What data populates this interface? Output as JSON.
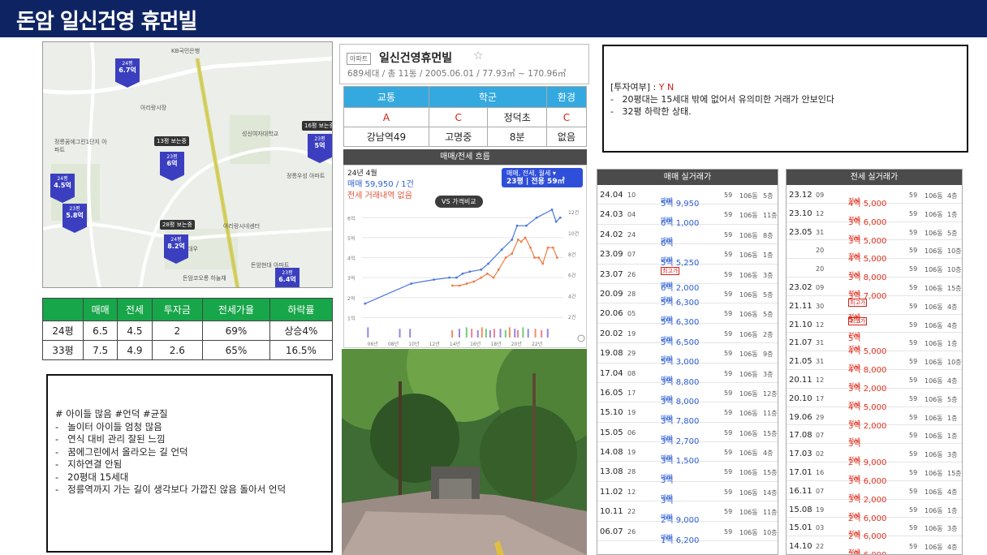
{
  "header": {
    "title": "돈암 일신건영 휴먼빌"
  },
  "map": {
    "pins": [
      {
        "py": "24평",
        "price": "6.7억"
      },
      {
        "py": "23평",
        "price": "6억"
      },
      {
        "py": "24평",
        "price": "4.5억"
      },
      {
        "py": "23평",
        "price": "5.8억"
      },
      {
        "py": "24평",
        "price": "8.2억"
      },
      {
        "py": "23평",
        "price": "5억"
      },
      {
        "py": "23평",
        "price": "6.4억"
      }
    ],
    "tags": [
      "13평 보는중",
      "28평 보는중",
      "16평 보는중"
    ],
    "labels": [
      "KB국민은행",
      "정릉꿈에그린1단지 아파트",
      "아리랑시장",
      "대우",
      "성신여자대학교",
      "정릉우성 아파트",
      "아리랑시네센터",
      "돈암코오롱 하늘채",
      "돈암현대 아파트"
    ]
  },
  "stats": {
    "headers": [
      "",
      "매매",
      "전세",
      "투자금",
      "전세가율",
      "하락률"
    ],
    "rows": [
      [
        "24평",
        "6.5",
        "4.5",
        "2",
        "69%",
        "상승4%"
      ],
      [
        "33평",
        "7.5",
        "4.9",
        "2.6",
        "65%",
        "16.5%"
      ]
    ]
  },
  "notes": {
    "tags": "# 아이들 많음 #언덕 #균질",
    "items": [
      "놀이터 아이들 엄청 많음",
      "연식 대비 관리 잘된 느낌",
      "꿈에그린에서 올라오는 길 언덕",
      "지하연결 안됨",
      "20평대 15세대",
      "정릉역까지 가는 길이 생각보다 가깝진 않음 돌아서 언덕"
    ]
  },
  "apt": {
    "badge": "아파트",
    "name": "일신건영휴먼빌",
    "star": "☆",
    "meta": "689세대 / 총 11동 / 2005.06.01 / 77.93㎡ ~ 170.96㎡"
  },
  "region": {
    "headers": [
      "교통",
      "학군",
      "환경"
    ],
    "grades": [
      "A",
      "C",
      "정덕초",
      "C"
    ],
    "details": [
      "강남역49",
      "고명중",
      "8분",
      "없음"
    ]
  },
  "chart": {
    "bar_title": "매매/전세 흐름",
    "date": "24년 4월",
    "sale": "매매 59,950 / 1건",
    "jeonse": "전세 거래내역 없음",
    "filter_line1": "매매, 전세, 월세 ▾",
    "filter_line2": "23평 | 전용 59㎡",
    "vs": "VS 가격비교"
  },
  "chart_data": {
    "type": "line",
    "x": [
      "06년",
      "08년",
      "10년",
      "12년",
      "14년",
      "16년",
      "18년",
      "20년",
      "22년"
    ],
    "yleft": [
      "1억",
      "2억",
      "3억",
      "4억",
      "5억",
      "6억"
    ],
    "yright": [
      "2건",
      "4건",
      "6건",
      "8건",
      "10건",
      "12건"
    ],
    "ylim": [
      0,
      6.5
    ],
    "series": [
      {
        "name": "매매",
        "color": "#4a77e0",
        "points": [
          [
            2005.3,
            1.7
          ],
          [
            2009.8,
            2.7
          ],
          [
            2012.0,
            2.9
          ],
          [
            2013.5,
            3.0
          ],
          [
            2014.2,
            3.0
          ],
          [
            2014.8,
            3.2
          ],
          [
            2015.5,
            3.3
          ],
          [
            2016.6,
            3.4
          ],
          [
            2017.3,
            3.7
          ],
          [
            2018.6,
            4.4
          ],
          [
            2019.6,
            4.9
          ],
          [
            2020.1,
            5.6
          ],
          [
            2021.0,
            5.6
          ],
          [
            2022.0,
            6.0
          ],
          [
            2023.5,
            6.4
          ],
          [
            2023.9,
            5.8
          ],
          [
            2024.3,
            6.0
          ]
        ]
      },
      {
        "name": "전세",
        "color": "#ef7b46",
        "points": [
          [
            2013.8,
            2.6
          ],
          [
            2014.5,
            2.6
          ],
          [
            2015.2,
            2.7
          ],
          [
            2015.9,
            2.8
          ],
          [
            2016.6,
            3.0
          ],
          [
            2017.2,
            3.2
          ],
          [
            2017.8,
            3.0
          ],
          [
            2018.3,
            3.4
          ],
          [
            2019.0,
            4.0
          ],
          [
            2019.6,
            4.2
          ],
          [
            2020.2,
            4.9
          ],
          [
            2020.5,
            4.8
          ],
          [
            2020.9,
            5.0
          ],
          [
            2021.4,
            4.5
          ],
          [
            2021.8,
            4.0
          ],
          [
            2022.2,
            4.0
          ],
          [
            2022.6,
            3.7
          ],
          [
            2023.1,
            4.5
          ],
          [
            2023.6,
            4.5
          ],
          [
            2024.0,
            4.0
          ]
        ]
      }
    ],
    "volume_colors": [
      "#8a6fd6",
      "#ef7b46",
      "#58c45a",
      "#e86a86"
    ],
    "volume": [
      [
        2005.5,
        1.4,
        0
      ],
      [
        2008.6,
        1.2,
        0
      ],
      [
        2009.6,
        1.2,
        0
      ],
      [
        2013.7,
        1.0,
        1
      ],
      [
        2014.4,
        1.2,
        0
      ],
      [
        2015.1,
        1.4,
        2
      ],
      [
        2015.6,
        1.2,
        3
      ],
      [
        2016.2,
        1.0,
        0
      ],
      [
        2016.6,
        1.4,
        1
      ],
      [
        2017.0,
        1.2,
        2
      ],
      [
        2017.4,
        1.0,
        0
      ],
      [
        2017.8,
        1.2,
        3
      ],
      [
        2018.4,
        1.2,
        0
      ],
      [
        2018.9,
        1.0,
        2
      ],
      [
        2019.3,
        1.4,
        1
      ],
      [
        2019.8,
        1.2,
        0
      ],
      [
        2020.1,
        1.0,
        3
      ],
      [
        2020.6,
        1.4,
        2
      ],
      [
        2021.1,
        1.2,
        0
      ],
      [
        2021.8,
        1.2,
        1
      ],
      [
        2022.4,
        1.0,
        3
      ],
      [
        2023.0,
        1.2,
        0
      ]
    ]
  },
  "invest": {
    "label": "[투자여부] : ",
    "yn": "Y N",
    "lines": [
      "20평대는 15세대 밖에 없어서 유의미한 거래가 안보인다",
      "32평 하락한 상태."
    ]
  },
  "sale_tx": {
    "title": "매매 실거래가",
    "rows": [
      {
        "d": "24.04",
        "day": "10",
        "k": "매매",
        "p": "5억 9,950",
        "a": "59",
        "dong": "106동",
        "fl": "5층",
        "hi": ""
      },
      {
        "d": "24.03",
        "day": "04",
        "k": "매매",
        "p": "6억 1,000",
        "a": "59",
        "dong": "106동",
        "fl": "11층",
        "hi": ""
      },
      {
        "d": "24.02",
        "day": "24",
        "k": "매매",
        "p": "6억",
        "a": "59",
        "dong": "106동",
        "fl": "8층",
        "hi": ""
      },
      {
        "d": "23.09",
        "day": "07",
        "k": "매매",
        "p": "5억 5,250",
        "a": "59",
        "dong": "106동",
        "fl": "1층",
        "hi": ""
      },
      {
        "d": "23.07",
        "day": "26",
        "k": "매매",
        "p": "6억 2,000",
        "a": "59",
        "dong": "106동",
        "fl": "3층",
        "hi": "최고가"
      },
      {
        "d": "20.09",
        "day": "28",
        "k": "매매",
        "p": "5억 6,300",
        "a": "59",
        "dong": "106동",
        "fl": "5층",
        "hi": ""
      },
      {
        "d": "20.06",
        "day": "05",
        "k": "매매",
        "p": "5억 6,300",
        "a": "59",
        "dong": "106동",
        "fl": "5층",
        "hi": ""
      },
      {
        "d": "20.02",
        "day": "19",
        "k": "매매",
        "p": "5억 6,500",
        "a": "59",
        "dong": "106동",
        "fl": "2층",
        "hi": ""
      },
      {
        "d": "19.08",
        "day": "29",
        "k": "매매",
        "p": "5억 3,000",
        "a": "59",
        "dong": "106동",
        "fl": "9층",
        "hi": ""
      },
      {
        "d": "17.04",
        "day": "08",
        "k": "매매",
        "p": "3억 8,800",
        "a": "59",
        "dong": "106동",
        "fl": "3층",
        "hi": ""
      },
      {
        "d": "16.05",
        "day": "17",
        "k": "매매",
        "p": "3억 8,000",
        "a": "59",
        "dong": "106동",
        "fl": "12층",
        "hi": ""
      },
      {
        "d": "15.10",
        "day": "19",
        "k": "매매",
        "p": "3억 7,800",
        "a": "59",
        "dong": "106동",
        "fl": "11층",
        "hi": ""
      },
      {
        "d": "15.05",
        "day": "06",
        "k": "매매",
        "p": "3억 2,700",
        "a": "59",
        "dong": "106동",
        "fl": "15층",
        "hi": ""
      },
      {
        "d": "14.08",
        "day": "19",
        "k": "매매",
        "p": "3억 1,500",
        "a": "59",
        "dong": "106동",
        "fl": "4층",
        "hi": ""
      },
      {
        "d": "13.08",
        "day": "28",
        "k": "매매",
        "p": "3억",
        "a": "59",
        "dong": "106동",
        "fl": "15층",
        "hi": ""
      },
      {
        "d": "11.02",
        "day": "12",
        "k": "매매",
        "p": "3억",
        "a": "59",
        "dong": "106동",
        "fl": "14층",
        "hi": ""
      },
      {
        "d": "10.11",
        "day": "22",
        "k": "매매",
        "p": "2억 9,000",
        "a": "59",
        "dong": "106동",
        "fl": "11층",
        "hi": ""
      },
      {
        "d": "06.07",
        "day": "26",
        "k": "매매",
        "p": "1억 6,200",
        "a": "59",
        "dong": "106동",
        "fl": "10층",
        "hi": ""
      }
    ]
  },
  "jeonse_tx": {
    "title": "전세 실거래가",
    "rows": [
      {
        "d": "23.12",
        "day": "09",
        "k": "전세",
        "p": "4억 5,000",
        "a": "59",
        "dong": "106동",
        "fl": "4층",
        "hi": ""
      },
      {
        "d": "23.10",
        "day": "12",
        "k": "전세",
        "p": "3억 6,000",
        "a": "59",
        "dong": "106동",
        "fl": "1층",
        "hi": ""
      },
      {
        "d": "23.05",
        "day": "31",
        "k": "전세",
        "p": "3억 5,000",
        "a": "59",
        "dong": "106동",
        "fl": "5층",
        "hi": ""
      },
      {
        "d": "",
        "day": "20",
        "k": "전세",
        "p": "4억 5,000",
        "a": "59",
        "dong": "106동",
        "fl": "10층",
        "hi": ""
      },
      {
        "d": "",
        "day": "20",
        "k": "전세",
        "p": "3억 8,000",
        "a": "59",
        "dong": "106동",
        "fl": "10층",
        "hi": ""
      },
      {
        "d": "23.02",
        "day": "09",
        "k": "전세",
        "p": "3억 7,000",
        "a": "59",
        "dong": "106동",
        "fl": "15층",
        "hi": ""
      },
      {
        "d": "21.11",
        "day": "30",
        "k": "전세",
        "p": "5억",
        "a": "59",
        "dong": "106동",
        "fl": "4층",
        "hi": "최고가"
      },
      {
        "d": "21.10",
        "day": "12",
        "k": "전세",
        "p": "5억",
        "a": "59",
        "dong": "106동",
        "fl": "4층",
        "hi": "최고가"
      },
      {
        "d": "21.07",
        "day": "31",
        "k": "전세",
        "p": "4억 5,000",
        "a": "59",
        "dong": "106동",
        "fl": "1층",
        "hi": ""
      },
      {
        "d": "21.05",
        "day": "31",
        "k": "전세",
        "p": "4억 8,000",
        "a": "59",
        "dong": "106동",
        "fl": "10층",
        "hi": ""
      },
      {
        "d": "20.11",
        "day": "12",
        "k": "전세",
        "p": "3억 2,000",
        "a": "59",
        "dong": "106동",
        "fl": "4층",
        "hi": ""
      },
      {
        "d": "20.10",
        "day": "17",
        "k": "전세",
        "p": "4억 5,000",
        "a": "59",
        "dong": "106동",
        "fl": "5층",
        "hi": ""
      },
      {
        "d": "19.06",
        "day": "29",
        "k": "전세",
        "p": "3억 2,000",
        "a": "59",
        "dong": "106동",
        "fl": "1층",
        "hi": ""
      },
      {
        "d": "17.08",
        "day": "07",
        "k": "전세",
        "p": "3억",
        "a": "59",
        "dong": "106동",
        "fl": "1층",
        "hi": ""
      },
      {
        "d": "17.03",
        "day": "02",
        "k": "전세",
        "p": "2억 9,000",
        "a": "59",
        "dong": "106동",
        "fl": "3층",
        "hi": ""
      },
      {
        "d": "17.01",
        "day": "16",
        "k": "전세",
        "p": "3억 6,000",
        "a": "59",
        "dong": "106동",
        "fl": "15층",
        "hi": ""
      },
      {
        "d": "16.11",
        "day": "07",
        "k": "전세",
        "p": "3억 2,000",
        "a": "59",
        "dong": "106동",
        "fl": "4층",
        "hi": ""
      },
      {
        "d": "15.08",
        "day": "19",
        "k": "전세",
        "p": "2억 6,000",
        "a": "59",
        "dong": "106동",
        "fl": "1층",
        "hi": ""
      },
      {
        "d": "15.01",
        "day": "03",
        "k": "전세",
        "p": "2억 6,000",
        "a": "59",
        "dong": "106동",
        "fl": "3층",
        "hi": ""
      },
      {
        "d": "14.10",
        "day": "22",
        "k": "전세",
        "p": "2억 6,000",
        "a": "59",
        "dong": "106동",
        "fl": "4층",
        "hi": ""
      }
    ]
  }
}
